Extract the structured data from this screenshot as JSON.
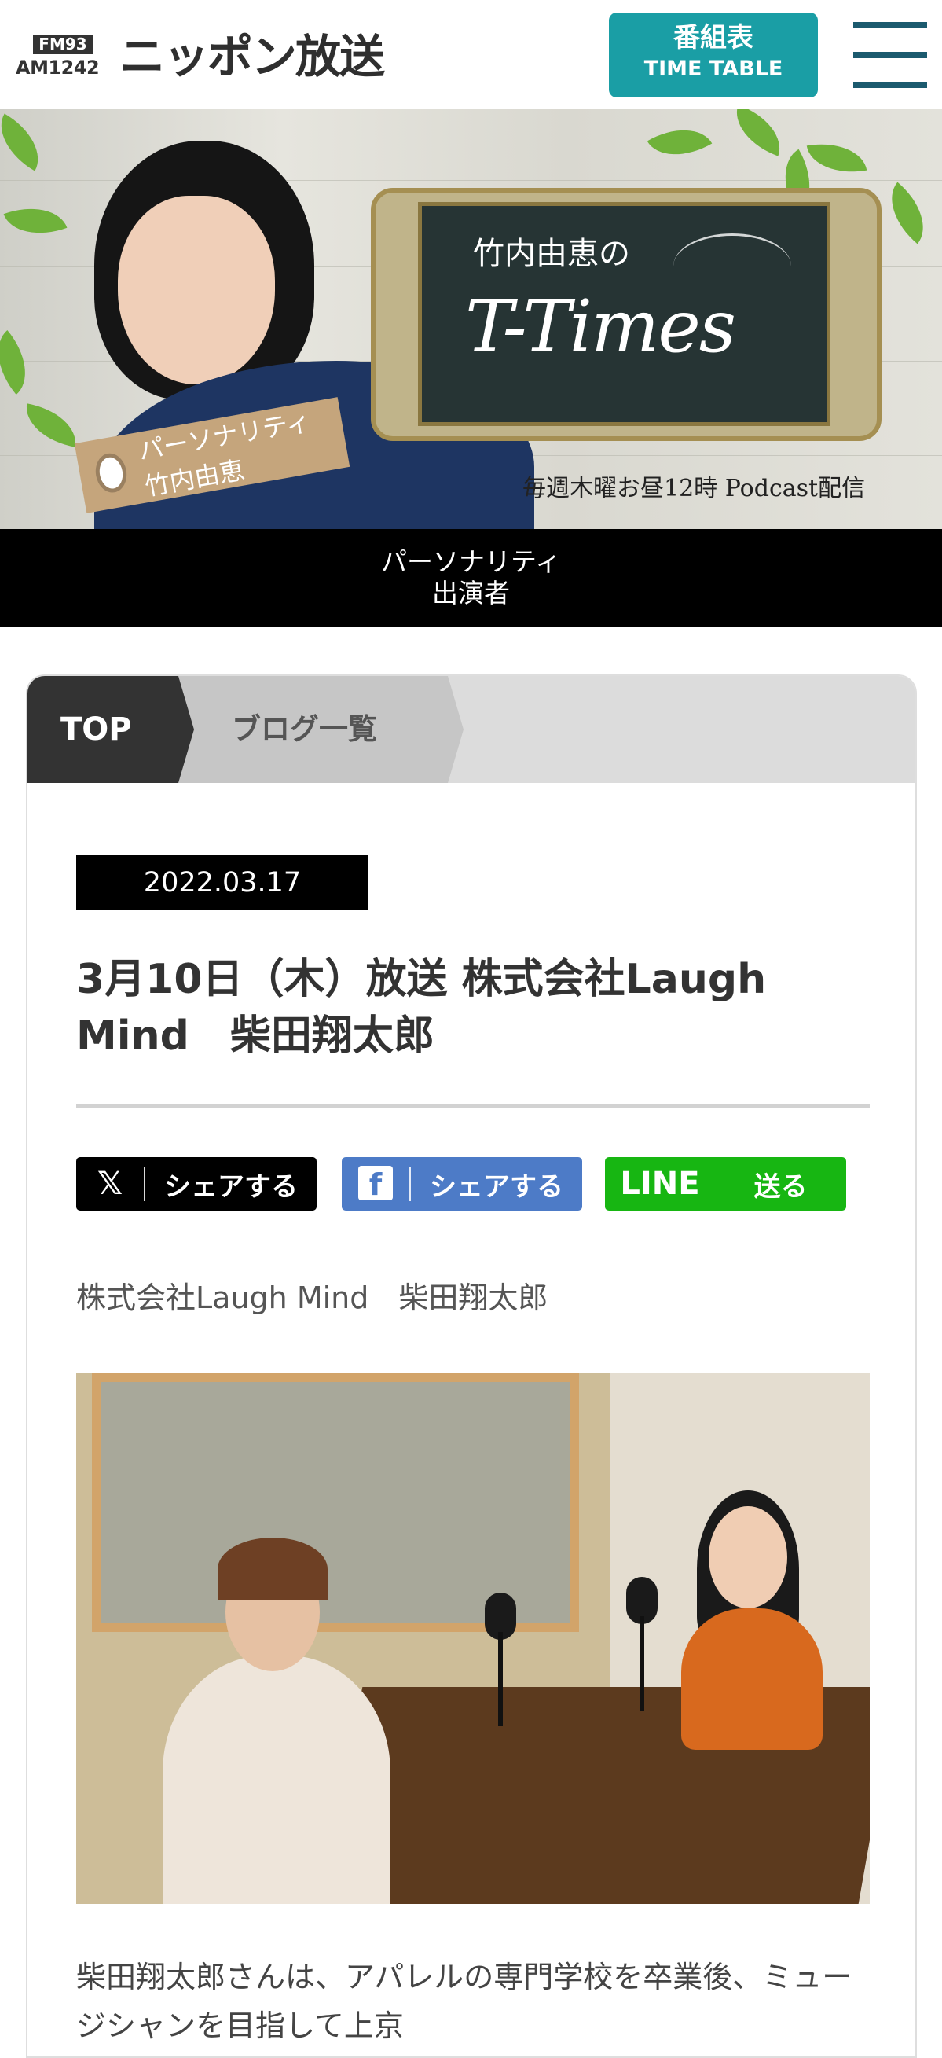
{
  "header": {
    "logo_fm": "FM93",
    "logo_am": "AM1242",
    "logo_name": "ニッポン放送",
    "timetable_jp": "番組表",
    "timetable_en": "TIME TABLE",
    "menu_icon": "hamburger-menu-icon"
  },
  "banner": {
    "board_title": "竹内由恵の",
    "board_logo": "T-Times",
    "tag_text": "パーソナリティ 竹内由恵",
    "caption": "毎週木曜お昼12時 Podcast配信"
  },
  "personality_nav": {
    "line1": "パーソナリティ",
    "line2": "出演者"
  },
  "breadcrumb": {
    "top": "TOP",
    "list": "ブログ一覧"
  },
  "post": {
    "date": "2022.03.17",
    "title": "3月10日（木）放送 株式会社Laugh Mind　柴田翔太郎",
    "lead": "株式会社Laugh Mind　柴田翔太郎",
    "body": "柴田翔太郎さんは、アパレルの専門学校を卒業後、ミュージシャンを目指して上京"
  },
  "share": {
    "x_icon": "𝕏",
    "x_label": "シェアする",
    "fb_icon": "f",
    "fb_label": "シェアする",
    "line_icon": "LINE",
    "line_label": "送る"
  },
  "colors": {
    "timetable": "#1a9ea5",
    "menu": "#1b5a6e",
    "facebook": "#4d7bc7",
    "line": "#17b612"
  }
}
